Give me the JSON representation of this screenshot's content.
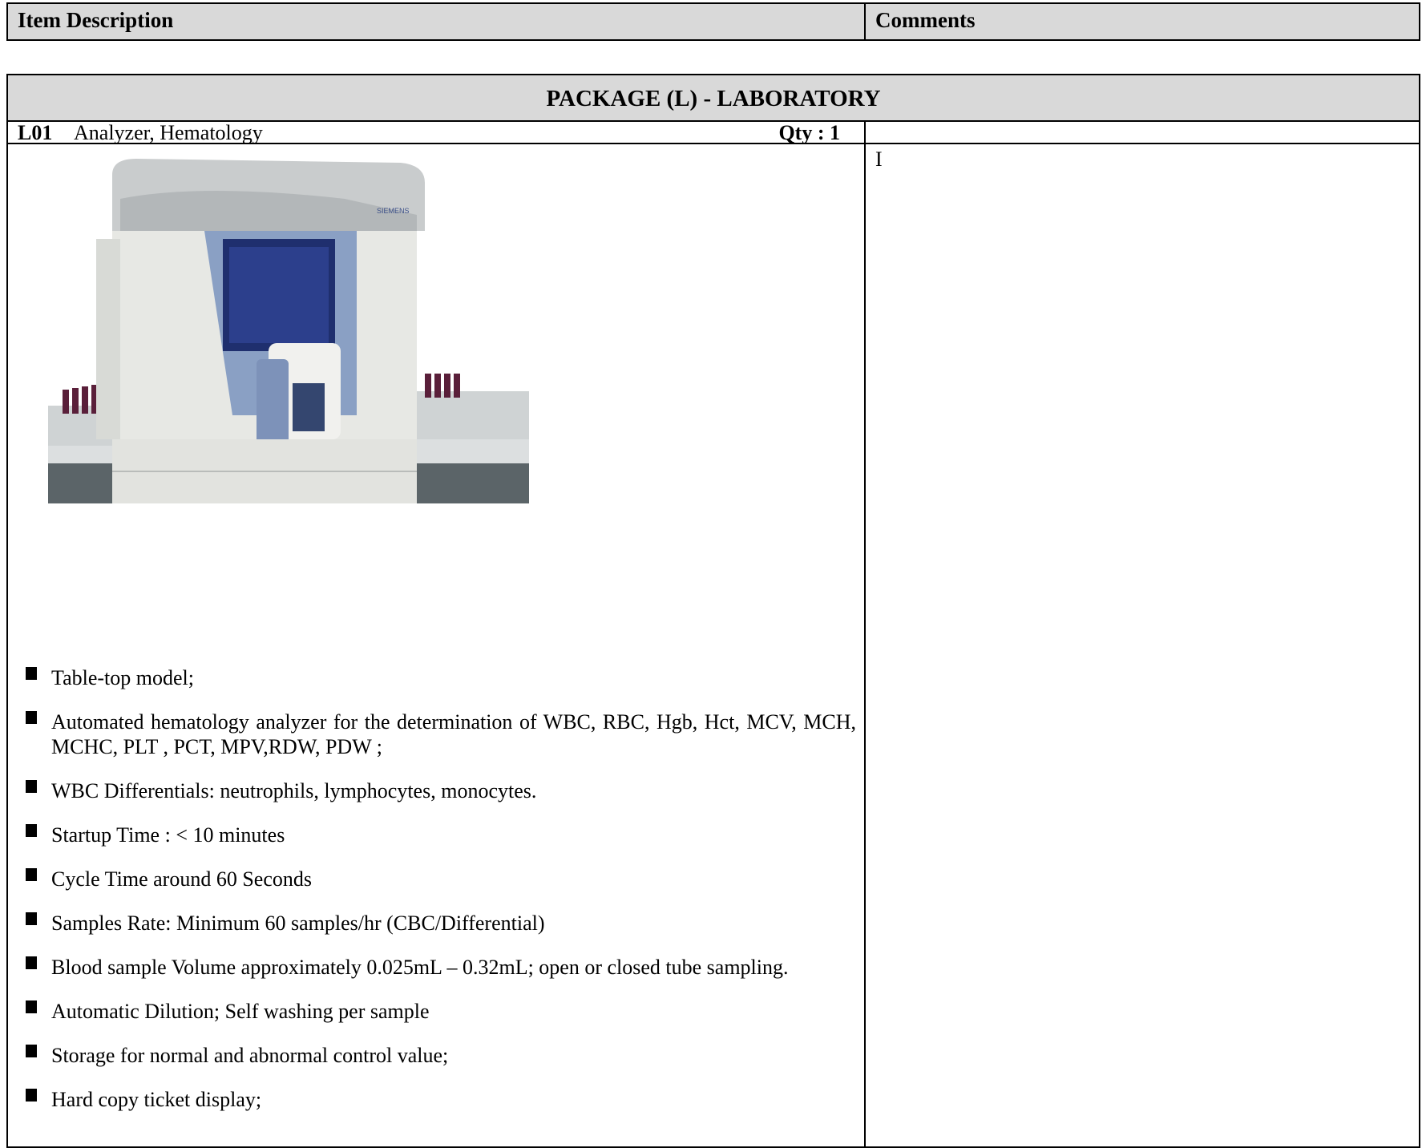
{
  "header": {
    "item_description_label": "Item Description",
    "comments_label": "Comments"
  },
  "package": {
    "title": "PACKAGE (L) - LABORATORY"
  },
  "item": {
    "code": "L01",
    "name": "Analyzer, Hematology",
    "qty_label": "Qty :  1",
    "comment_text": "I",
    "image_brand_text": "SIEMENS"
  },
  "specs": [
    "Table-top model;",
    "Automated  hematology analyzer for the determination of WBC, RBC, Hgb, Hct, MCV, MCH, MCHC, PLT , PCT, MPV,RDW, PDW ;",
    "WBC Differentials: neutrophils, lymphocytes, monocytes.",
    "Startup Time : < 10 minutes",
    "Cycle Time around 60 Seconds",
    "Samples Rate: Minimum  60 samples/hr (CBC/Differential)",
    "Blood sample Volume approximately 0.025mL – 0.32mL; open or closed tube sampling.",
    "Automatic Dilution; Self washing per sample",
    "Storage for normal and abnormal control value;",
    "Hard copy ticket display;"
  ]
}
